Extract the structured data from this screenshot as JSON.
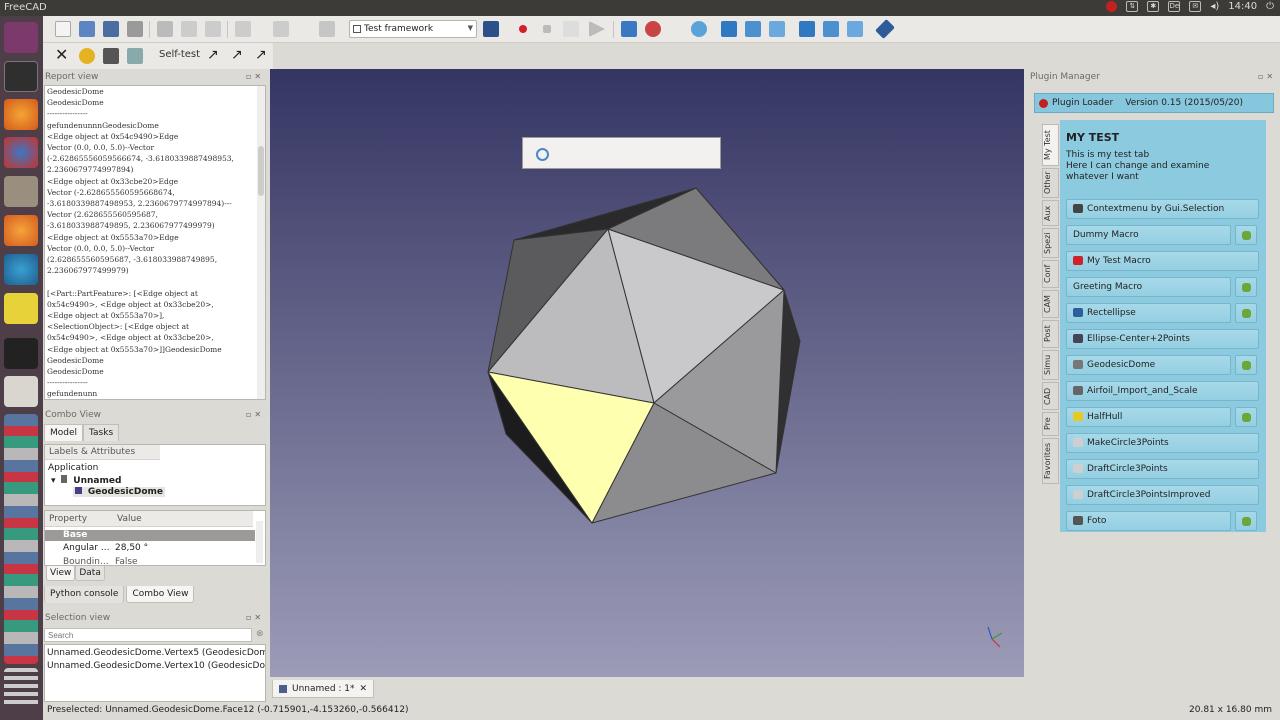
{
  "topbar": {
    "app_title": "FreeCAD",
    "clock": "14:40"
  },
  "toolbar": {
    "workbench": "Test framework",
    "selftest_label": "Self-test"
  },
  "report": {
    "title": "Report view",
    "lines": [
      "GeodesicDome",
      "GeodesicDome",
      "----------------",
      "gefundenunnnGeodesicDome",
      "<Edge object at 0x54c9490>Edge",
      "Vector (0.0, 0.0, 5.0)--Vector",
      "(-2.62865556059566674, -3.618033988749895​3,",
      "2.236067977499789​4)",
      "<Edge object at 0x33cbe20>Edge",
      "Vector (-2.628655560595668674,",
      "-3.6180339887498953, 2.2360679774997894)---",
      "Vector (2.628655560595687,",
      "-3.618033988749895, 2.236067977499979)",
      "<Edge object at 0x5553a70>Edge",
      "Vector (0.0, 0.0, 5.0)--Vector",
      "(2.628655560595687, -3.618033988749895,",
      "2.236067977499979)",
      "",
      "[<Part::PartFeature>: [<Edge object at",
      "0x54c9490>, <Edge object at 0x33cbe20>,",
      "<Edge object at 0x5553a70>],",
      "<SelectionObject>: [<Edge object at",
      "0x54c9490>, <Edge object at 0x33cbe20>,",
      "<Edge object at 0x5553a70>]]GeodesicDome",
      "GeodesicDome",
      "GeodesicDome",
      "----------------",
      "gefundenunn"
    ]
  },
  "combo": {
    "title": "Combo View",
    "tabs": [
      "Model",
      "Tasks"
    ],
    "labels_header": "Labels & Attributes",
    "tree": {
      "root": "Application",
      "doc": "Unnamed",
      "object": "GeodesicDome"
    },
    "property": {
      "col_property": "Property",
      "col_value": "Value",
      "group": "Base",
      "row_name": "Angular ...",
      "row_value": "28,50 °",
      "row3_name": "Boundin...",
      "row3_value": "False"
    },
    "view_tabs": [
      "View",
      "Data"
    ],
    "bottom_tabs": [
      "Python console",
      "Combo View"
    ]
  },
  "selection": {
    "title": "Selection view",
    "search_placeholder": "Search",
    "items": [
      "Unnamed.GeodesicDome.Vertex5 (GeodesicDome)",
      "Unnamed.GeodesicDome.Vertex10 (GeodesicDome)"
    ]
  },
  "document_tab": {
    "label": "Unnamed : 1*"
  },
  "plugin_manager": {
    "title": "Plugin Manager",
    "loader_name": "Plugin Loader",
    "loader_version": "Version 0.15 (2015/05/20)",
    "vertical_tabs": [
      "My Test",
      "Other",
      "Aux",
      "Spezi",
      "Conf",
      "CAM",
      "Post",
      "Simu",
      "CAD",
      "Pre",
      "Favorites"
    ],
    "heading": "MY TEST",
    "description": "This is my test tab\nHere I can change and examine\nwhatever I want",
    "buttons": [
      {
        "label": "Contextmenu by Gui.Selection",
        "gear": false,
        "icon_color": "#444"
      },
      {
        "label": "Dummy Macro",
        "gear": true,
        "icon_color": ""
      },
      {
        "label": "My Test Macro",
        "gear": false,
        "icon_color": "#d0222a"
      },
      {
        "label": "Greeting Macro",
        "gear": true,
        "icon_color": ""
      },
      {
        "label": "Rectellipse",
        "gear": true,
        "icon_color": "#2d5f9a"
      },
      {
        "label": "Ellipse-Center+2Points",
        "gear": false,
        "icon_color": "#445"
      },
      {
        "label": "GeodesicDome",
        "gear": true,
        "icon_color": "#777"
      },
      {
        "label": "Airfoil_Import_and_Scale",
        "gear": false,
        "icon_color": "#666"
      },
      {
        "label": "HalfHull",
        "gear": true,
        "icon_color": "#e8c822"
      },
      {
        "label": "MakeCircle3Points",
        "gear": false,
        "icon_color": "#cfcfcf"
      },
      {
        "label": "DraftCircle3Points",
        "gear": false,
        "icon_color": "#cfcfcf"
      },
      {
        "label": "DraftCircle3PointsImproved",
        "gear": false,
        "icon_color": "#cfcfcf"
      },
      {
        "label": "Foto",
        "gear": true,
        "icon_color": "#555"
      }
    ]
  },
  "status": {
    "preselected": "Preselected: Unnamed.GeodesicDome.Face12 (-0.715901,-4.153260,-0.566412)",
    "dimensions": "20.81 x 16.80 mm"
  },
  "colors": {
    "background_top": "#353563",
    "background_bottom": "#9c9cb8",
    "selected_face": "#ffffb0",
    "plugin_panel": "#8ccbdf"
  }
}
